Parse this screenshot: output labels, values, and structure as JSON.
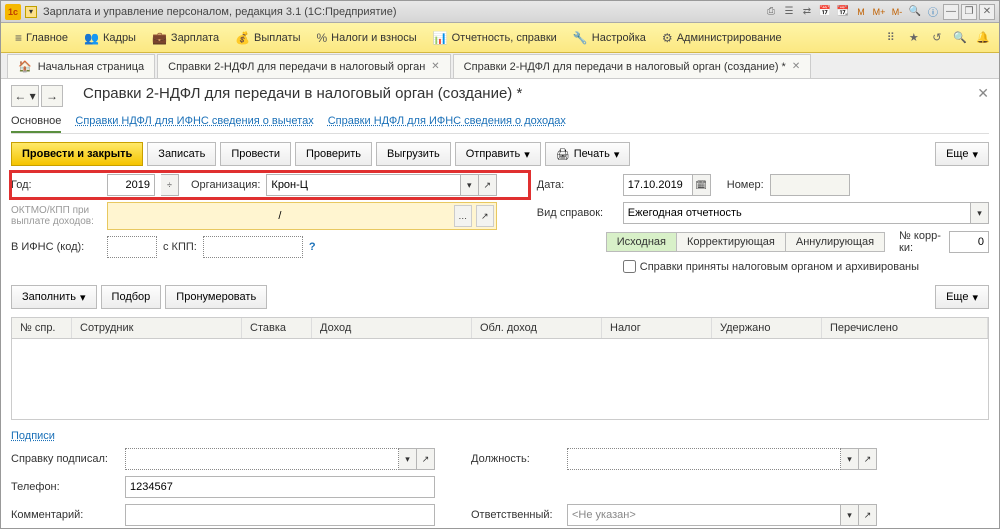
{
  "titlebar": {
    "app_title": "Зарплата и управление персоналом, редакция 3.1  (1С:Предприятие)"
  },
  "mainmenu": {
    "items": [
      "Главное",
      "Кадры",
      "Зарплата",
      "Выплаты",
      "Налоги и взносы",
      "Отчетность, справки",
      "Настройка",
      "Администрирование"
    ]
  },
  "tabs": {
    "t0": "Начальная страница",
    "t1": "Справки 2-НДФЛ для передачи в налоговый орган",
    "t2": "Справки 2-НДФЛ для передачи в налоговый орган (создание) *"
  },
  "page": {
    "title": "Справки 2-НДФЛ для передачи в налоговый орган (создание) *"
  },
  "subtabs": {
    "main": "Основное",
    "link1": "Справки НДФЛ для ИФНС сведения о вычетах",
    "link2": "Справки НДФЛ для ИФНС сведения о доходах"
  },
  "toolbar": {
    "post_close": "Провести и закрыть",
    "write": "Записать",
    "post": "Провести",
    "check": "Проверить",
    "export": "Выгрузить",
    "send": "Отправить",
    "print": "Печать",
    "more": "Еще"
  },
  "form": {
    "year_label": "Год:",
    "year_value": "2019",
    "org_label": "Организация:",
    "org_value": "Крон-Ц",
    "oktmo_label": "ОКТМО/КПП при выплате доходов:",
    "oktmo_value": "/",
    "ifns_label": "В ИФНС (код):",
    "kpp_label": "с КПП:",
    "date_label": "Дата:",
    "date_value": "17.10.2019",
    "number_label": "Номер:",
    "kind_label": "Вид справок:",
    "kind_value": "Ежегодная отчетность",
    "seg_original": "Исходная",
    "seg_correcting": "Корректирующая",
    "seg_annul": "Аннулирующая",
    "corr_label": "№ корр-ки:",
    "corr_value": "0",
    "archived_label": "Справки приняты налоговым органом и архивированы"
  },
  "table_toolbar": {
    "fill": "Заполнить",
    "select": "Подбор",
    "number": "Пронумеровать",
    "more": "Еще"
  },
  "table": {
    "cols": [
      "№ спр.",
      "Сотрудник",
      "Ставка",
      "Доход",
      "Обл. доход",
      "Налог",
      "Удержано",
      "Перечислено"
    ]
  },
  "bottom": {
    "signs_link": "Подписи",
    "signed_label": "Справку подписал:",
    "position_label": "Должность:",
    "phone_label": "Телефон:",
    "phone_value": "1234567",
    "comment_label": "Комментарий:",
    "resp_label": "Ответственный:",
    "resp_value": "<Не указан>"
  }
}
